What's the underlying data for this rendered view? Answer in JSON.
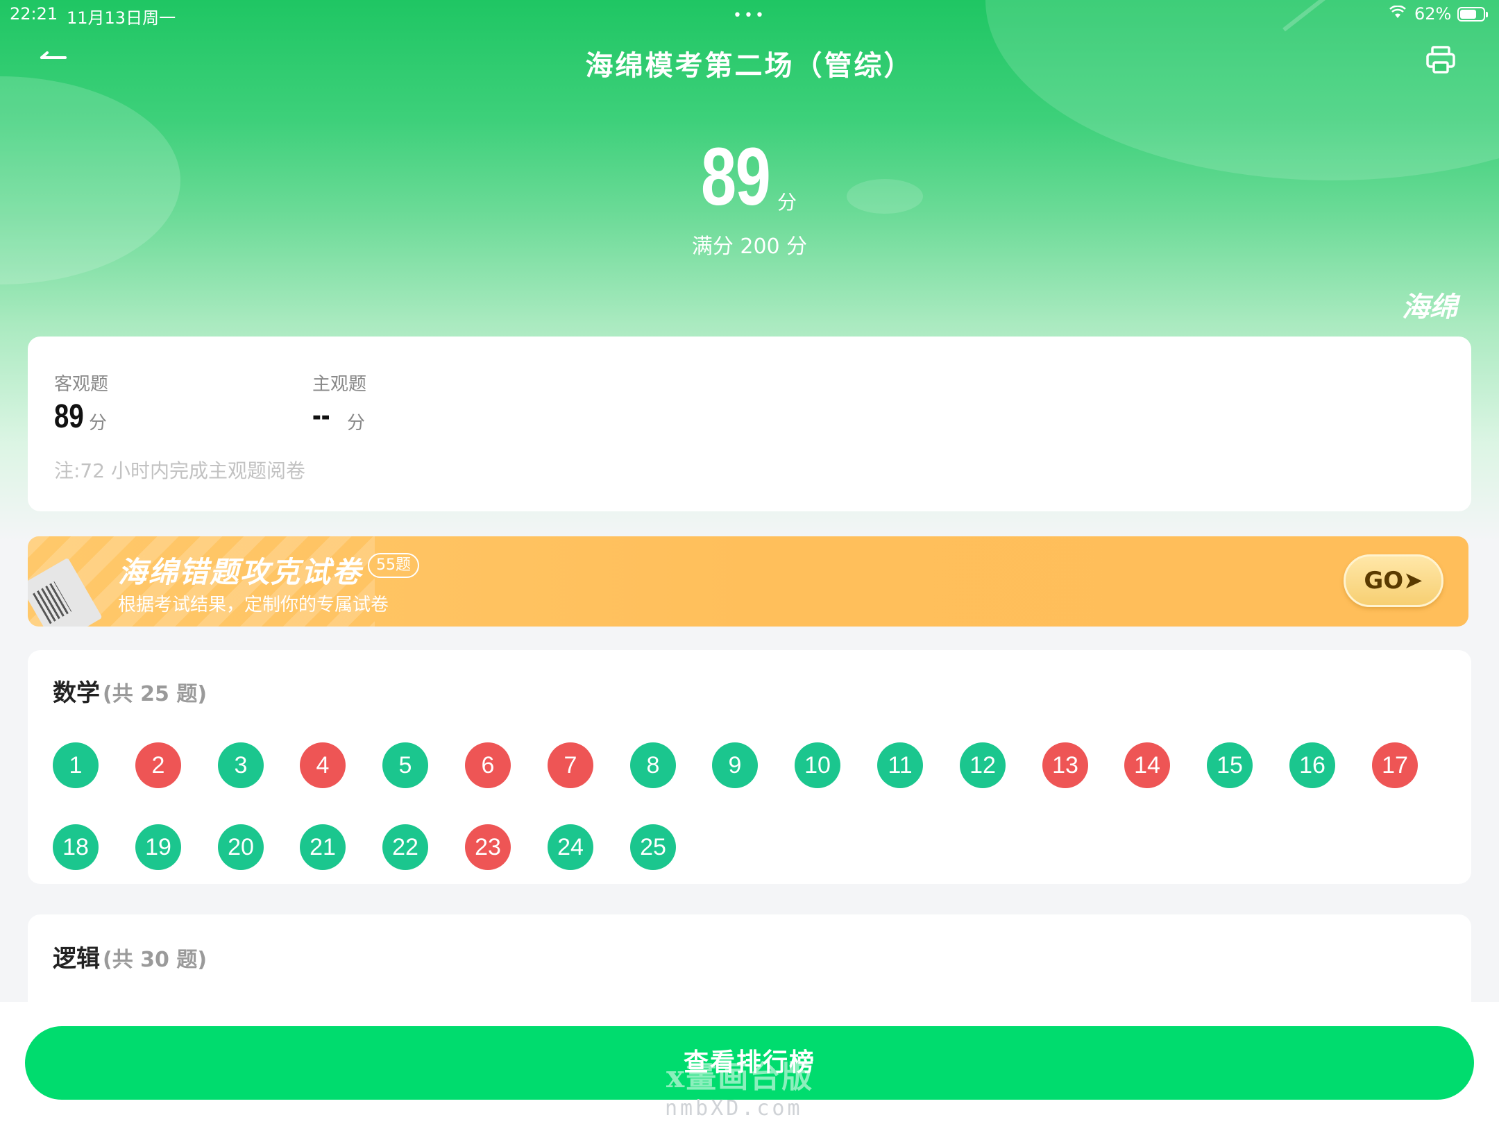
{
  "status_bar": {
    "time": "22:21",
    "date": "11月13日周一",
    "battery_pct": "62%",
    "battery_level": 0.62
  },
  "header": {
    "title": "海绵模考第二场（管综）",
    "back_icon": "arrow-left-icon",
    "print_icon": "printer-icon"
  },
  "score": {
    "value": "89",
    "unit": "分",
    "full": "满分 200 分",
    "brand": "海绵"
  },
  "score_card": {
    "objective_label": "客观题",
    "objective_value": "89",
    "subjective_label": "主观题",
    "subjective_value": "--",
    "unit": "分",
    "note": "注:72 小时内完成主观题阅卷"
  },
  "promo": {
    "title": "海绵错题攻克试卷",
    "badge": "55题",
    "subtitle": "根据考试结果，定制你的专属试卷",
    "go_label": "GO➤"
  },
  "math": {
    "title": "数学",
    "count": "(共 25 题)",
    "questions": [
      {
        "n": "1",
        "correct": true
      },
      {
        "n": "2",
        "correct": false
      },
      {
        "n": "3",
        "correct": true
      },
      {
        "n": "4",
        "correct": false
      },
      {
        "n": "5",
        "correct": true
      },
      {
        "n": "6",
        "correct": false
      },
      {
        "n": "7",
        "correct": false
      },
      {
        "n": "8",
        "correct": true
      },
      {
        "n": "9",
        "correct": true
      },
      {
        "n": "10",
        "correct": true
      },
      {
        "n": "11",
        "correct": true
      },
      {
        "n": "12",
        "correct": true
      },
      {
        "n": "13",
        "correct": false
      },
      {
        "n": "14",
        "correct": false
      },
      {
        "n": "15",
        "correct": true
      },
      {
        "n": "16",
        "correct": true
      },
      {
        "n": "17",
        "correct": false
      },
      {
        "n": "18",
        "correct": true
      },
      {
        "n": "19",
        "correct": true
      },
      {
        "n": "20",
        "correct": true
      },
      {
        "n": "21",
        "correct": true
      },
      {
        "n": "22",
        "correct": true
      },
      {
        "n": "23",
        "correct": false
      },
      {
        "n": "24",
        "correct": true
      },
      {
        "n": "25",
        "correct": true
      }
    ]
  },
  "logic": {
    "title": "逻辑",
    "count": "(共 30 题)"
  },
  "bottom": {
    "rank_button": "查看排行榜",
    "watermark": "x畫画台版",
    "watermark_url": "nmbXD.com"
  },
  "colors": {
    "green_header": "#1fc663",
    "correct": "#1bc68e",
    "wrong": "#ee5555",
    "button": "#00dc6e",
    "promo": "#ffbf5b"
  }
}
